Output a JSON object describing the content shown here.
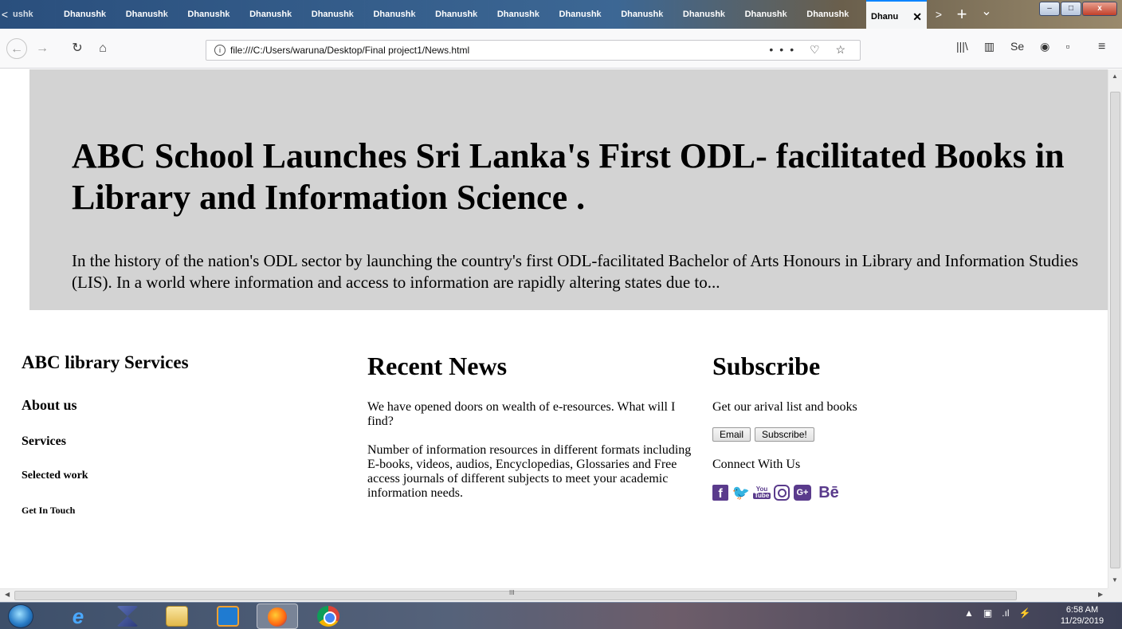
{
  "browser": {
    "tab_scroll_left": "<",
    "first_tab_label": "ushk",
    "tab_labels": [
      "Dhanushk",
      "Dhanushk",
      "Dhanushk",
      "Dhanushk",
      "Dhanushk",
      "Dhanushk",
      "Dhanushk",
      "Dhanushk",
      "Dhanushk",
      "Dhanushk",
      "Dhanushk",
      "Dhanushk",
      "Dhanushk"
    ],
    "active_tab_label": "Dhanu",
    "active_tab_close": "✕",
    "new_tab": "+",
    "tab_list": "⌄",
    "tab_scroll_right": ">",
    "url": "file:///C:/Users/waruna/Desktop/Final project1/News.html",
    "url_info_icon": "i",
    "url_actions": "••• ♡ ☆",
    "toolbar_icons": [
      "library-icon",
      "sidebar-icon",
      "selenium-icon",
      "account-icon",
      "extension-icon"
    ],
    "menu_icon": "≡"
  },
  "hero": {
    "title": "ABC School Launches Sri Lanka's First ODL- facilitated Books in Library and Information Science .",
    "summary": "In the history of the nation's ODL sector by launching the country's first ODL-facilitated Bachelor of Arts Honours in Library and Information Studies (LIS). In a world where information and access to information are rapidly altering states due to..."
  },
  "footer": {
    "left": {
      "heading": "ABC library Services",
      "about": "About us",
      "services": "Services",
      "selected_work": "Selected work",
      "get_in_touch": "Get In Touch"
    },
    "middle": {
      "heading": "Recent News",
      "paragraph1": "We have opened doors on wealth of e-resources. What will I find?",
      "paragraph2": "Number of information resources in different formats including E-books, videos, audios, Encyclopedias, Glossaries and Free access journals of different subjects to meet your academic information needs."
    },
    "right": {
      "heading": "Subscribe",
      "intro": "Get our arival list and books",
      "email_button": "Email",
      "subscribe_button": "Subscribe!",
      "connect": "Connect With Us",
      "social": {
        "facebook": "f",
        "twitter": "🐦",
        "youtube_top": "You",
        "youtube_bottom": "Tube",
        "googleplus": "G+",
        "behance": "Bē"
      }
    }
  },
  "scrollbar": {
    "hscroll_grip": "III"
  },
  "taskbar": {
    "clock_time": "6:58 AM",
    "clock_date": "11/29/2019",
    "tray_icons": [
      "show-hidden-icon",
      "network-error-icon",
      "signal-icon",
      "power-icon"
    ]
  },
  "colors": {
    "hero_background": "#d3d3d3",
    "social_icon": "#5a3b8c",
    "active_tab_accent": "#0a84ff"
  }
}
